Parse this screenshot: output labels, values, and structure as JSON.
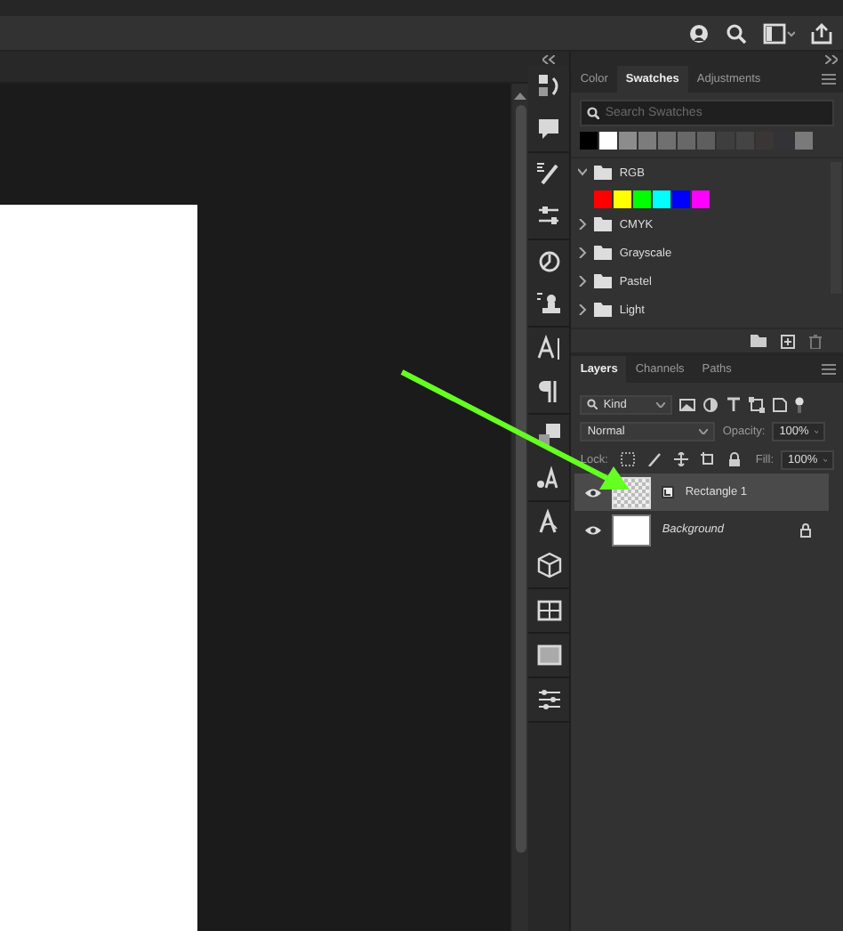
{
  "swatches_panel": {
    "tabs": [
      {
        "label": "Color",
        "selected": false
      },
      {
        "label": "Swatches",
        "selected": true
      },
      {
        "label": "Adjustments",
        "selected": false
      }
    ],
    "search": {
      "placeholder": "Search Swatches"
    },
    "recent_swatches": [
      {
        "color": "#000000"
      },
      {
        "color": "#ffffff"
      },
      {
        "color": "#8c8c8c"
      },
      {
        "color": "#7c7c7c"
      },
      {
        "color": "#707070"
      },
      {
        "color": "#686868"
      },
      {
        "color": "#5e5e5e"
      },
      {
        "color": "#3e3e3e"
      },
      {
        "color": "#444444"
      },
      {
        "color": "#3b3636"
      },
      {
        "color": "#333337"
      },
      {
        "color": "#7a7a7a"
      }
    ],
    "groups": [
      {
        "name": "RGB",
        "expanded": true,
        "swatches": [
          {
            "color": "#ff0000"
          },
          {
            "color": "#ffff00"
          },
          {
            "color": "#00ff00"
          },
          {
            "color": "#00ffff"
          },
          {
            "color": "#0000ff"
          },
          {
            "color": "#ff00ff"
          }
        ]
      },
      {
        "name": "CMYK",
        "expanded": false
      },
      {
        "name": "Grayscale",
        "expanded": false
      },
      {
        "name": "Pastel",
        "expanded": false
      },
      {
        "name": "Light",
        "expanded": false
      }
    ]
  },
  "layers_panel": {
    "tabs": [
      {
        "label": "Layers",
        "selected": true
      },
      {
        "label": "Channels",
        "selected": false
      },
      {
        "label": "Paths",
        "selected": false
      }
    ],
    "filter": "Kind",
    "blend_mode": "Normal",
    "opacity_label": "Opacity:",
    "opacity": "100%",
    "lock_label": "Lock:",
    "fill_label": "Fill:",
    "fill": "100%",
    "layers": [
      {
        "name": "Rectangle 1",
        "kind": "shape",
        "selected": true,
        "visible": true,
        "locked": false
      },
      {
        "name": "Background",
        "kind": "background",
        "selected": false,
        "visible": true,
        "locked": true
      }
    ]
  }
}
